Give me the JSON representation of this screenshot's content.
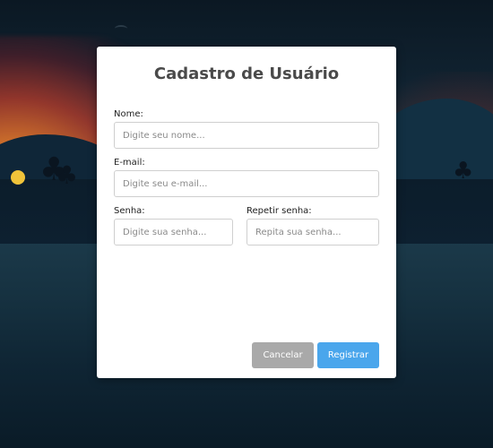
{
  "form": {
    "title": "Cadastro de Usuário",
    "name": {
      "label": "Nome:",
      "placeholder": "Digite seu nome...",
      "value": ""
    },
    "email": {
      "label": "E-mail:",
      "placeholder": "Digite seu e-mail...",
      "value": ""
    },
    "password": {
      "label": "Senha:",
      "placeholder": "Digite sua senha...",
      "value": ""
    },
    "password_confirm": {
      "label": "Repetir senha:",
      "placeholder": "Repita sua senha...",
      "value": ""
    }
  },
  "actions": {
    "cancel_label": "Cancelar",
    "register_label": "Registrar"
  },
  "colors": {
    "primary": "#4aa6ec",
    "secondary": "#a9a9a9",
    "title": "#4a4a4a"
  }
}
